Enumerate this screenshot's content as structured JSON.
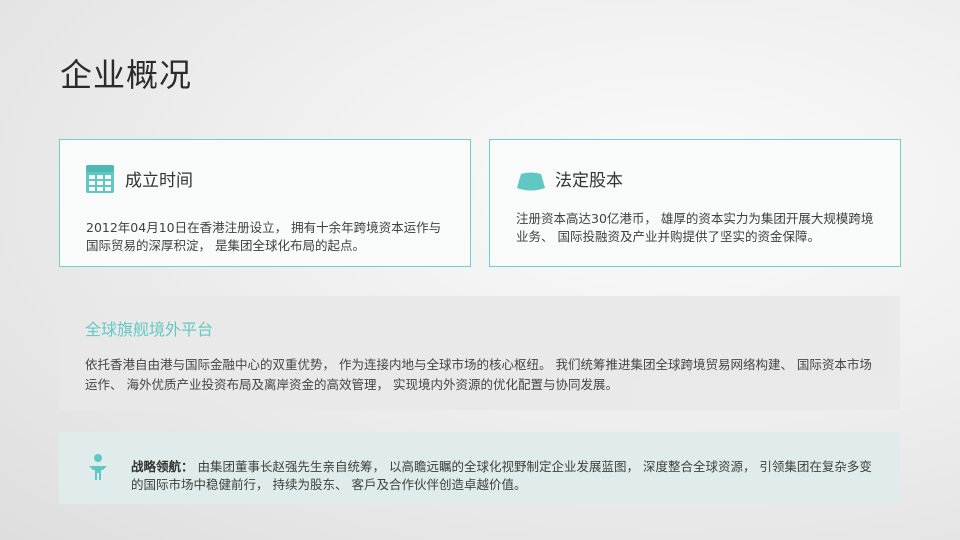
{
  "page": {
    "title": "企业概况"
  },
  "cards": {
    "founding": {
      "icon": "calendar-icon",
      "title": "成立时间",
      "body": "2012年04月10日在香港注册设立， 拥有十余年跨境资本运作与国际贸易的深厚积淀， 是集团全球化布局的起点。"
    },
    "capital": {
      "icon": "ingot-icon",
      "title": "法定股本",
      "body": "注册资本高达30亿港币， 雄厚的资本实力为集团开展大规模跨境业务、 国际投融资及产业并购提供了坚实的资金保障。"
    }
  },
  "platform": {
    "title": "全球旗舰境外平台",
    "body": "依托香港自由港与国际金融中心的双重优势， 作为连接内地与全球市场的核心枢纽。 我们统筹推进集团全球跨境贸易网络构建、 国际资本市场运作、 海外优质产业投资布局及离岸资金的高效管理， 实现境内外资源的优化配置与协同发展。"
  },
  "strategy": {
    "icon": "person-icon",
    "label": "战略领航：",
    "body": "由集团董事长赵强先生亲自统筹， 以高瞻远瞩的全球化视野制定企业发展蓝图， 深度整合全球资源， 引领集团在复杂多变的国际市场中稳健前行， 持续为股东、 客戶及合作伙伴创造卓越价值。"
  },
  "colors": {
    "accent": "#5fc8c2",
    "card_border": "#6ed1c8",
    "strategy_bg": "#dfeceb",
    "platform_bg": "#e9e9e9"
  }
}
